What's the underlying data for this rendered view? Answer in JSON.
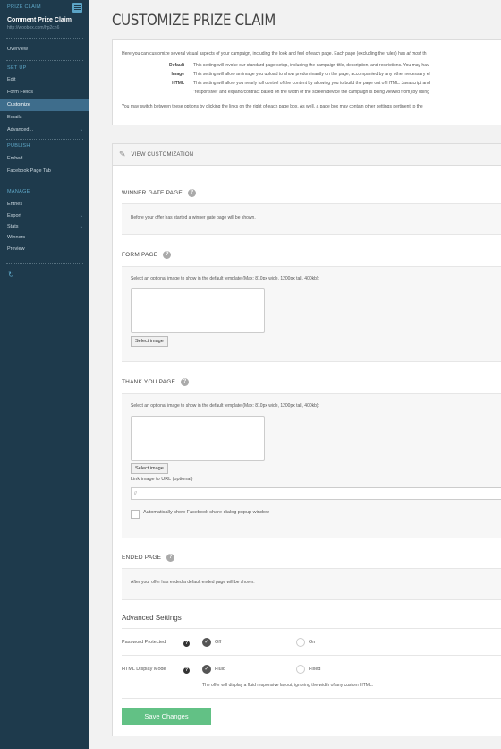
{
  "sidebar": {
    "campaign_type": "PRIZE CLAIM",
    "campaign_name": "Comment Prize Claim",
    "campaign_url": "http://woobox.com/hp2cn6",
    "overview": "Overview",
    "setup_heading": "SET UP",
    "setup_items": [
      "Edit",
      "Form Fields",
      "Customize",
      "Emails",
      "Advanced..."
    ],
    "publish_heading": "PUBLISH",
    "publish_items": [
      "Embed",
      "Facebook Page Tab"
    ],
    "manage_heading": "MANAGE",
    "manage_items": [
      "Entries",
      "Export",
      "Stats",
      "Winners",
      "Preview"
    ]
  },
  "page": {
    "title": "CUSTOMIZE PRIZE CLAIM"
  },
  "intro": {
    "line1_a": "Here you can customize several visual aspects of your campaign, including the look and feel of each page. Each page (excluding the rules) has ",
    "line1_em": "at most",
    "line1_b": " th",
    "options": [
      {
        "key": "Default",
        "text": "This setting will invoke our standard page setup, including the campaign title, description, and restrictions. You may hav"
      },
      {
        "key": "Image",
        "text": "This setting will allow an image you upload to show predominantly on the page, accompanied by any other necessary el"
      },
      {
        "key": "HTML",
        "text": "This setting will allow you nearly full control of the content by allowing you to build the page out of HTML. Javascript and"
      }
    ],
    "html_cont": "\"responsive\" and expand/contract based on the width of the screen/device the campaign is being viewed from) by using",
    "footer": "You may switch between these options by clicking the links on the right of each page box. As well, a page box may contain other settings pertinent to the"
  },
  "customization": {
    "header_label": "VIEW CUSTOMIZATION",
    "winner_gate": {
      "title": "WINNER GATE PAGE",
      "text": "Before your offer has started a winner gate page will be shown."
    },
    "form_page": {
      "title": "FORM PAGE",
      "text": "Select an optional image to show in the default template (Max: 810px wide, 1200px tall, 400kb):",
      "button": "Select image"
    },
    "thank_you": {
      "title": "THANK YOU PAGE",
      "text": "Select an optional image to show in the default template (Max: 810px wide, 1200px tall, 400kb):",
      "button": "Select image",
      "link_label": "Link image to URL (optional)",
      "link_placeholder": "//",
      "share_label": "Automatically show Facebook share dialog popup window"
    },
    "ended": {
      "title": "ENDED PAGE",
      "text": "After your offer has ended a default ended page will be shown."
    }
  },
  "advanced": {
    "title": "Advanced Settings",
    "password": {
      "label": "Password Protected",
      "opt1": "Off",
      "opt2": "On",
      "selected": "Off"
    },
    "display": {
      "label": "HTML Display Mode",
      "opt1": "Fluid",
      "opt2": "Fixed",
      "selected": "Fluid",
      "note": "The offer will display a fluid responsive layout, ignoring the width of any custom HTML."
    },
    "save": "Save Changes"
  },
  "colors": {
    "sidebar_bg": "#1e3a4c",
    "sidebar_active": "#3e6d8c",
    "accent": "#5fa8c8",
    "save_button": "#62c185"
  },
  "icons": {
    "menu": "menu-icon",
    "refresh": "refresh-icon",
    "edit": "pencil-icon",
    "help": "help-icon",
    "check": "check-icon"
  }
}
